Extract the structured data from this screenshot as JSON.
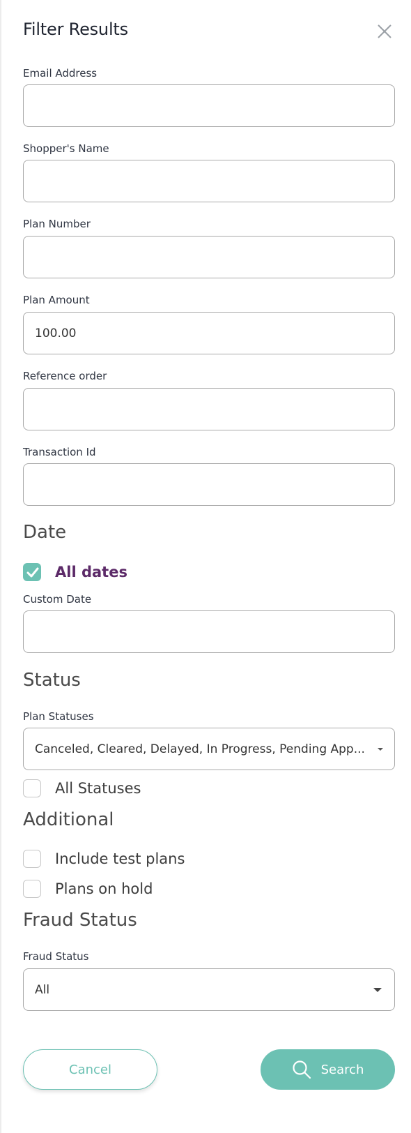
{
  "header": {
    "title": "Filter Results",
    "close_icon": "close-icon"
  },
  "fields": {
    "email": {
      "label": "Email Address",
      "value": ""
    },
    "shopper_name": {
      "label": "Shopper's Name",
      "value": ""
    },
    "plan_number": {
      "label": "Plan Number",
      "value": ""
    },
    "plan_amount": {
      "label": "Plan Amount",
      "value": "100.00"
    },
    "reference_order": {
      "label": "Reference order",
      "value": ""
    },
    "transaction_id": {
      "label": "Transaction Id",
      "value": ""
    }
  },
  "date": {
    "heading": "Date",
    "all_dates": {
      "label": "All dates",
      "checked": true
    },
    "custom_date": {
      "label": "Custom Date",
      "value": ""
    }
  },
  "status": {
    "heading": "Status",
    "plan_statuses": {
      "label": "Plan Statuses",
      "value": "Canceled, Cleared, Delayed, In Progress, Pending App..."
    },
    "all_statuses": {
      "label": "All Statuses",
      "checked": false
    }
  },
  "additional": {
    "heading": "Additional",
    "include_test_plans": {
      "label": "Include test plans",
      "checked": false
    },
    "plans_on_hold": {
      "label": "Plans on hold",
      "checked": false
    }
  },
  "fraud": {
    "heading": "Fraud Status",
    "select": {
      "label": "Fraud Status",
      "value": "All"
    }
  },
  "actions": {
    "cancel_label": "Cancel",
    "search_label": "Search"
  },
  "colors": {
    "accent": "#6cc1b3",
    "checked_label": "#5c2a68"
  }
}
